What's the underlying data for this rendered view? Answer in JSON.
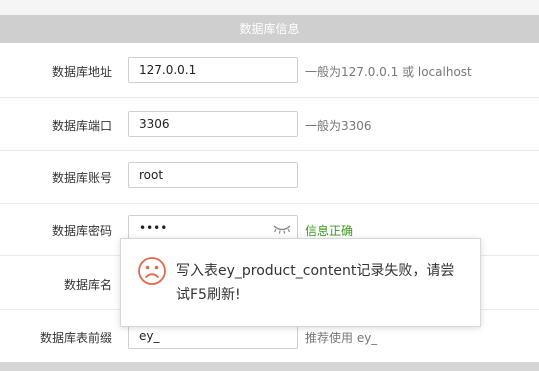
{
  "section": {
    "title": "数据库信息"
  },
  "fields": {
    "host": {
      "label": "数据库地址",
      "value": "127.0.0.1",
      "hint": "一般为127.0.0.1 或 localhost"
    },
    "port": {
      "label": "数据库端口",
      "value": "3306",
      "hint": "一般为3306"
    },
    "user": {
      "label": "数据库账号",
      "value": "root"
    },
    "password": {
      "label": "数据库密码",
      "value": "••••",
      "hint": "信息正确"
    },
    "name": {
      "label": "数据库名"
    },
    "prefix": {
      "label": "数据库表前缀",
      "value": "ey_",
      "hint": "推荐使用 ey_"
    }
  },
  "dialog": {
    "message": "写入表ey_product_content记录失败，请尝试F5刷新!"
  },
  "colors": {
    "header_bg": "#cfcfcf",
    "success": "#3a9a1e",
    "error_icon": "#e06a4c"
  },
  "icons": {
    "password_toggle": "eye-closed-icon",
    "dialog": "sad-face-icon"
  }
}
